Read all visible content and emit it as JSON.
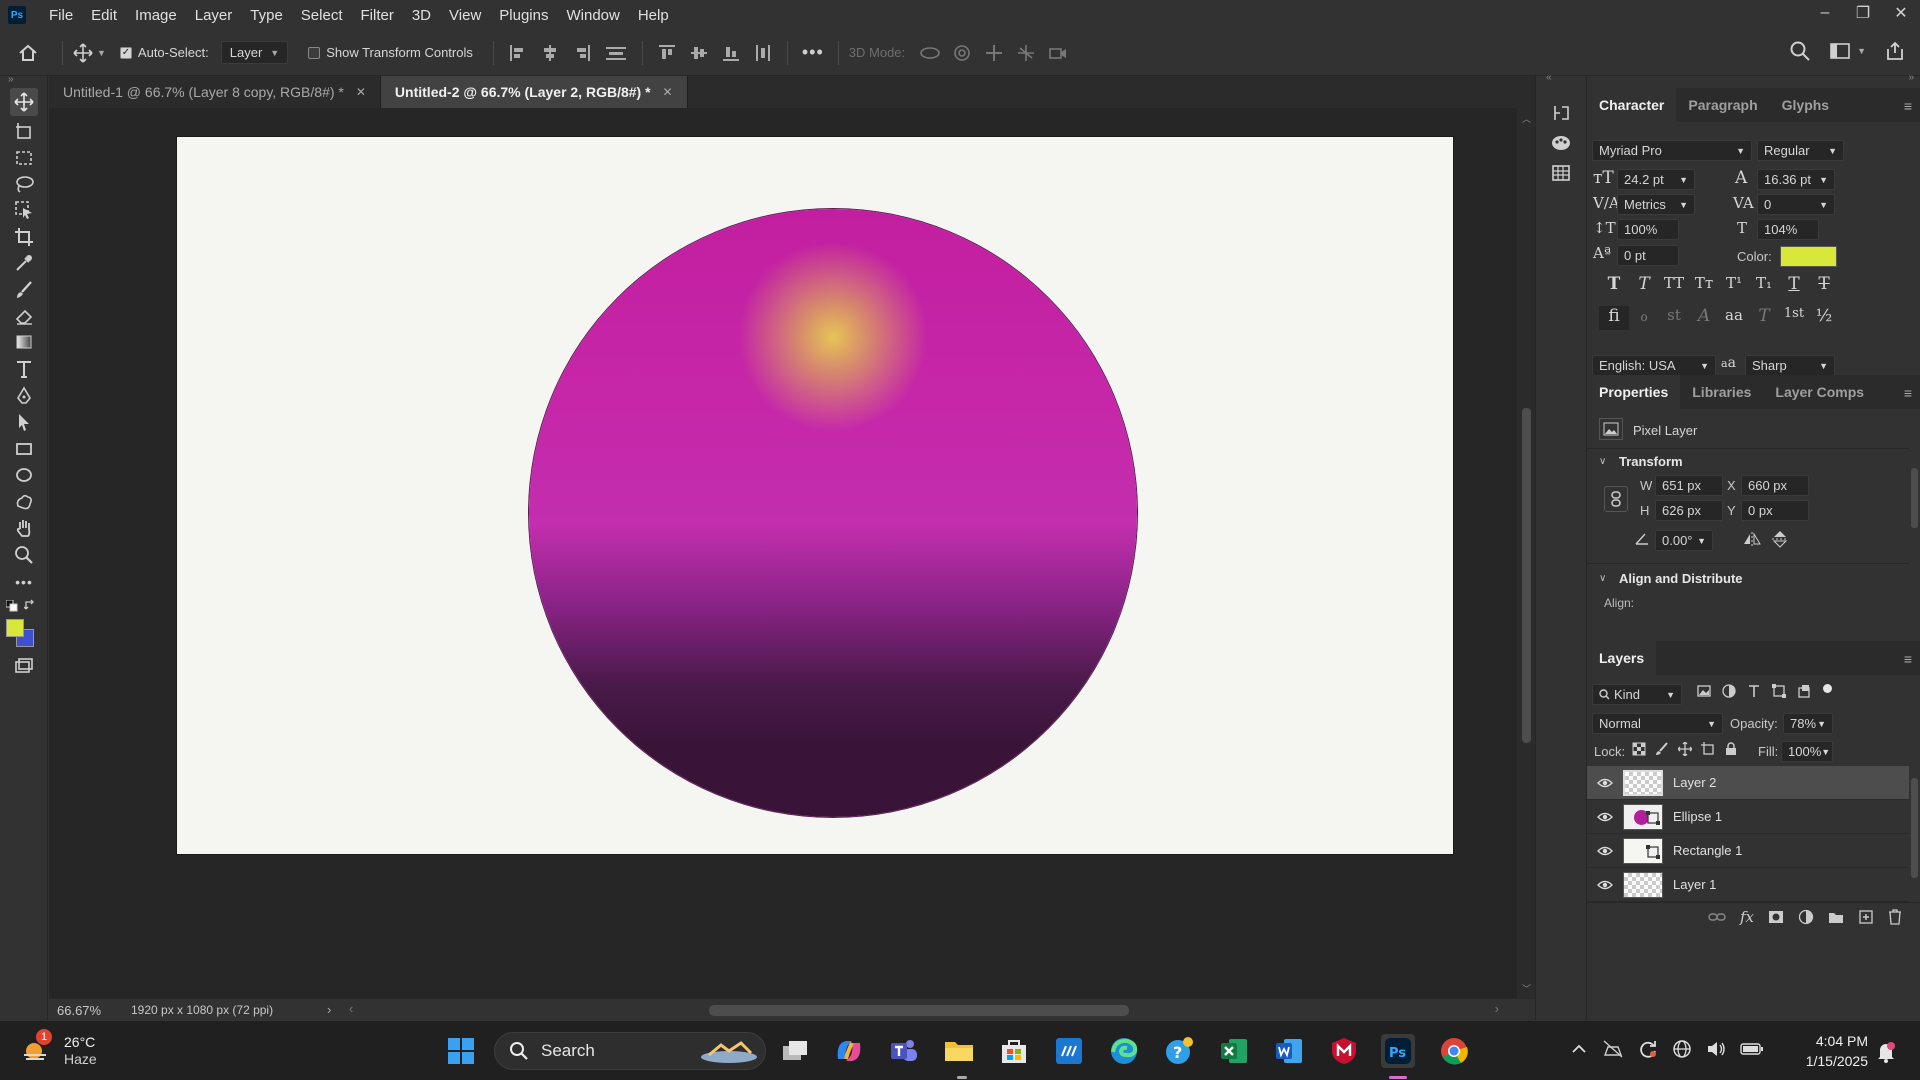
{
  "menubar": {
    "app_badge": "Ps",
    "items": [
      "File",
      "Edit",
      "Image",
      "Layer",
      "Type",
      "Select",
      "Filter",
      "3D",
      "View",
      "Plugins",
      "Window",
      "Help"
    ]
  },
  "options": {
    "auto_select_label": "Auto-Select:",
    "auto_select_target": "Layer",
    "show_transform_label": "Show Transform Controls",
    "three_d_mode_label": "3D Mode:"
  },
  "tabs": [
    {
      "label": "Untitled-1 @ 66.7% (Layer 8 copy, RGB/8#) *"
    },
    {
      "label": "Untitled-2 @ 66.7% (Layer 2, RGB/8#) *"
    }
  ],
  "status": {
    "zoom": "66.67%",
    "doc_info": "1920 px x 1080 px (72 ppi)"
  },
  "character": {
    "tabs": [
      "Character",
      "Paragraph",
      "Glyphs"
    ],
    "font_family": "Myriad Pro",
    "font_style": "Regular",
    "font_size": "24.2 pt",
    "leading": "16.36 pt",
    "kerning": "Metrics",
    "tracking": "0",
    "vertical_scale": "100%",
    "horizontal_scale": "104%",
    "baseline_shift": "0 pt",
    "color_label": "Color:",
    "color": "#d8e83a",
    "language": "English: USA",
    "antialias_icon_text": "a",
    "antialias": "Sharp",
    "style_glyphs": [
      "T",
      "T",
      "TT",
      "Tт",
      "T¹",
      "T₁",
      "T",
      "T"
    ],
    "opentype_glyphs": [
      "fi",
      "ℴ",
      "st",
      "A",
      "aa",
      "T",
      "1st",
      "½"
    ]
  },
  "properties": {
    "tabs": [
      "Properties",
      "Libraries",
      "Layer Comps"
    ],
    "kind": "Pixel Layer",
    "transform_label": "Transform",
    "w_label": "W",
    "w": "651 px",
    "h_label": "H",
    "h": "626 px",
    "x_label": "X",
    "x": "660 px",
    "y_label": "Y",
    "y": "0 px",
    "angle": "0.00°",
    "align_label": "Align and Distribute",
    "align_sub": "Align:"
  },
  "layers": {
    "title": "Layers",
    "filter": "Kind",
    "blend_mode": "Normal",
    "opacity_label": "Opacity:",
    "opacity": "78%",
    "lock_label": "Lock:",
    "fill_label": "Fill:",
    "fill": "100%",
    "items": [
      {
        "name": "Layer 2"
      },
      {
        "name": "Ellipse 1"
      },
      {
        "name": "Rectangle 1"
      },
      {
        "name": "Layer 1"
      }
    ]
  },
  "taskbar": {
    "weather_temp": "26°C",
    "weather_desc": "Haze",
    "weather_badge": "1",
    "search_label": "Search",
    "time": "4:04 PM",
    "date": "1/15/2025"
  },
  "colors": {
    "foreground": "#d8e83a",
    "background": "#3f4fd0"
  }
}
